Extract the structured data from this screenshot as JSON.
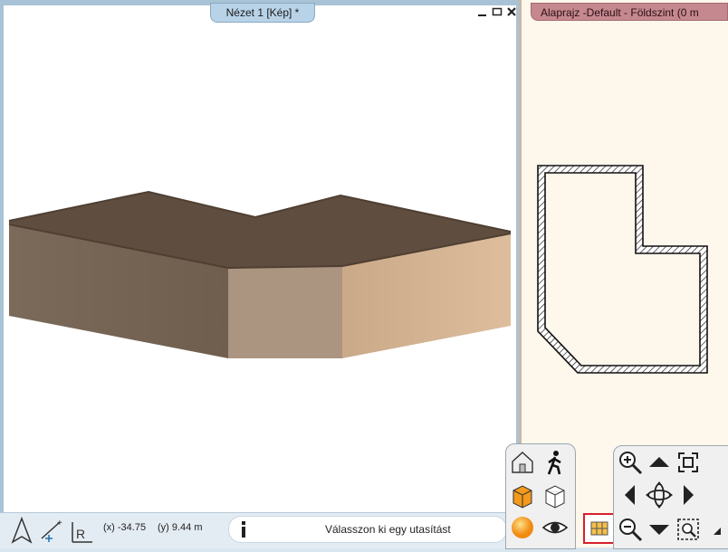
{
  "view3d": {
    "title": "Nézet 1 [Kép] *",
    "window_controls": [
      "minimize-icon",
      "maximize-icon",
      "close-icon"
    ]
  },
  "plan_view": {
    "title": "Alaprajz -Default - Földszint (0 m"
  },
  "status_bar": {
    "icons": [
      "north-arrow-icon",
      "coordinate-input-icon",
      "relative-coordinate-icon"
    ],
    "coord_x": "(x) -34.75",
    "coord_y": "(y) 9.44 m",
    "message": "Válasszon ki egy utasítást"
  },
  "nav_palette": {
    "left": [
      "house-view-icon",
      "walk-icon",
      "solid-cube-icon",
      "wire-cube-icon",
      "render-sphere-icon",
      "eye-icon"
    ],
    "right": [
      "zoom-in-icon",
      "arrow-up-icon",
      "zoom-extents-icon",
      "arrow-left-icon",
      "orbit-icon",
      "arrow-right-icon",
      "zoom-out-icon",
      "arrow-down-icon",
      "zoom-window-icon"
    ],
    "layer_button": "layer-icon"
  },
  "colors": {
    "wall_dark": "#7a6858",
    "wall_light": "#d7b594",
    "plan_bg": "#fdf7ec",
    "plan_tab": "#c6888f",
    "view_tab": "#b8d3e8",
    "highlight": "#d6202c"
  }
}
